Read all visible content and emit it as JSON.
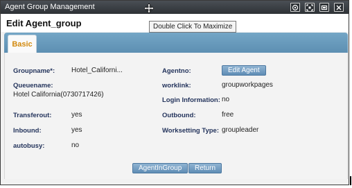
{
  "window": {
    "title": "Agent Group Management",
    "tooltip": "Double Click To Maximize"
  },
  "page": {
    "title": "Edit Agent_group"
  },
  "tabs": [
    {
      "label": "Basic",
      "active": true
    }
  ],
  "fields": {
    "groupname": {
      "label": "Groupname*:",
      "value": "Hotel_Californi..."
    },
    "agentno": {
      "label": "Agentno:",
      "button": "Edit Agent"
    },
    "queuename": {
      "label": "Queuename:",
      "value": "Hotel California(0730717426)"
    },
    "worklink": {
      "label": "worklink:",
      "value": "groupworkpages"
    },
    "login_information": {
      "label": "Login Information:",
      "value": "no"
    },
    "transferout": {
      "label": "Transferout:",
      "value": "yes"
    },
    "outbound": {
      "label": "Outbound:",
      "value": "free"
    },
    "inbound": {
      "label": "Inbound:",
      "value": "yes"
    },
    "worksetting_type": {
      "label": "Worksetting Type:",
      "value": "groupleader"
    },
    "autobusy": {
      "label": "autobusy:",
      "value": "no"
    }
  },
  "actions": {
    "agent_in_group": "AgentInGroup",
    "return": "Return"
  },
  "colors": {
    "titlebar": "#34383c",
    "tab_bar": "#6a9cbe",
    "tab_label": "#d28a0f",
    "field_label": "#24345c",
    "button": "#7aa3c6"
  }
}
